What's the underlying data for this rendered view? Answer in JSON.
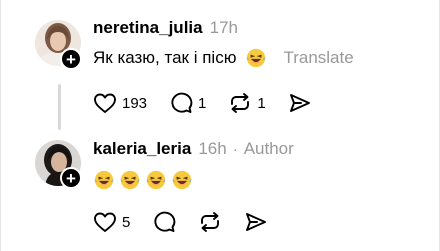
{
  "posts": [
    {
      "username": "neretina_julia",
      "time": "17h",
      "text": "Як казю, так і пісю",
      "emoji_count": 1,
      "translate_label": "Translate",
      "likes": "193",
      "replies": "1",
      "reposts": "1"
    },
    {
      "username": "kaleria_leria",
      "time": "16h",
      "separator": "·",
      "author_label": "Author",
      "emoji_count": 4,
      "likes": "5"
    }
  ],
  "icons": {
    "emoji": "grinning-squinting-tear-face-icon",
    "like": "heart-icon",
    "reply": "comment-icon",
    "repost": "repost-icon",
    "share": "send-icon",
    "follow": "plus-icon"
  },
  "colors": {
    "muted": "#999999",
    "thread_line": "#d9d9d9",
    "emoji_face": "#f7c93c",
    "emoji_tears": "#6fb4ef"
  },
  "follow_symbol": "+"
}
